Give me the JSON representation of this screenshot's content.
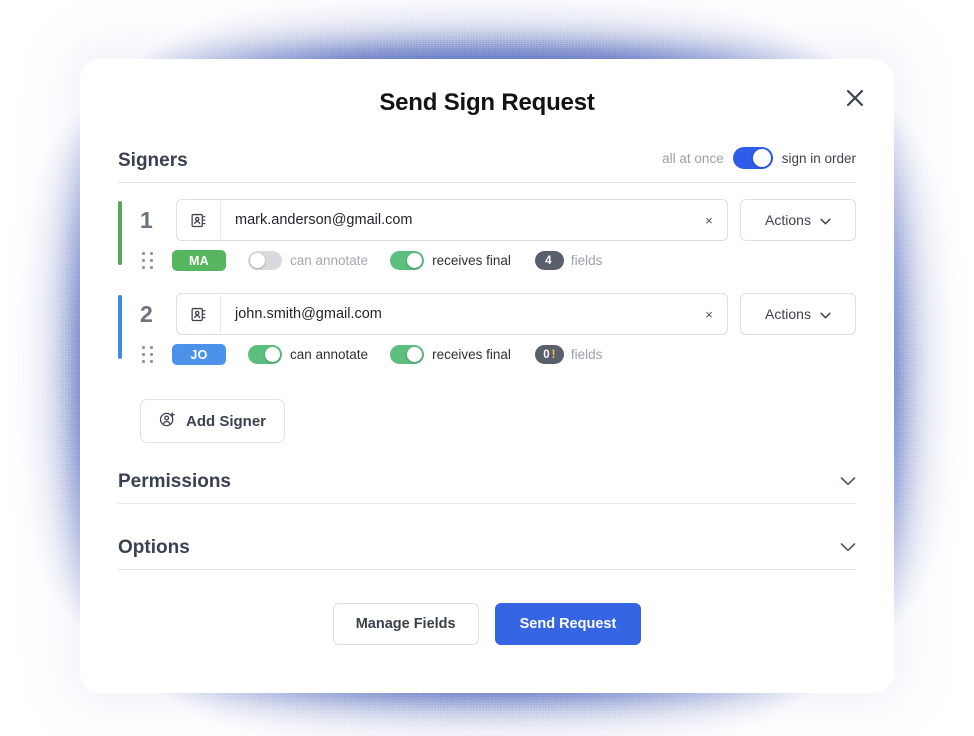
{
  "modal": {
    "title": "Send Sign Request",
    "close_icon": "close-icon"
  },
  "signers_section": {
    "title": "Signers",
    "order_toggle": {
      "label_off": "all at once",
      "label_on": "sign in order",
      "state": "on",
      "color": "#2f5ce8"
    },
    "rows": [
      {
        "number": "1",
        "accent_color": "#56a85a",
        "email": "mark.anderson@gmail.com",
        "clear_icon": "×",
        "actions_label": "Actions",
        "initials": "MA",
        "initials_color": "#56b65e",
        "can_annotate": {
          "label": "can annotate",
          "state": "off"
        },
        "receives_final": {
          "label": "receives final",
          "state": "on"
        },
        "fields": {
          "count": "4",
          "warning": "",
          "label": "fields"
        }
      },
      {
        "number": "2",
        "accent_color": "#3b8ce0",
        "email": "john.smith@gmail.com",
        "clear_icon": "×",
        "actions_label": "Actions",
        "initials": "JO",
        "initials_color": "#4c91ea",
        "can_annotate": {
          "label": "can annotate",
          "state": "on"
        },
        "receives_final": {
          "label": "receives final",
          "state": "on"
        },
        "fields": {
          "count": "0",
          "warning": "!",
          "label": "fields"
        }
      }
    ],
    "add_signer_label": "Add Signer",
    "add_signer_icon": "user-plus-icon"
  },
  "permissions_section": {
    "title": "Permissions",
    "chevron_icon": "chevron-down-icon"
  },
  "options_section": {
    "title": "Options",
    "chevron_icon": "chevron-down-icon"
  },
  "footer": {
    "manage_fields_label": "Manage Fields",
    "send_request_label": "Send Request",
    "primary_color": "#3565e3"
  }
}
